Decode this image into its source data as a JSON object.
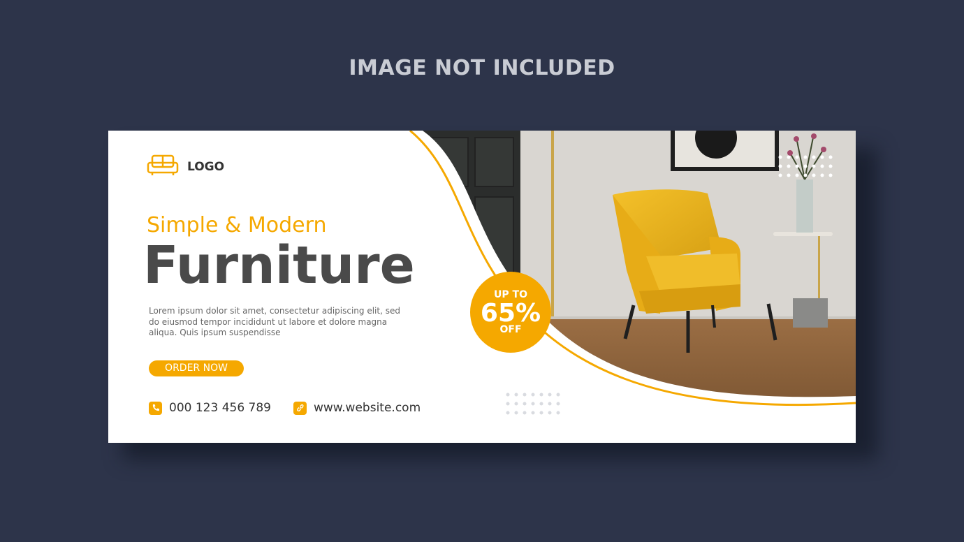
{
  "header": {
    "label": "IMAGE NOT INCLUDED"
  },
  "banner": {
    "logo": {
      "icon": "sofa-icon",
      "text": "LOGO"
    },
    "subtitle": "Simple & Modern",
    "title": "Furniture",
    "body": "Lorem ipsum dolor sit amet, consectetur adipiscing elit, sed do eiusmod tempor incididunt ut labore et dolore magna aliqua. Quis ipsum suspendisse",
    "order_button": "ORDER NOW",
    "phone": {
      "icon": "phone-icon",
      "text": "000 123 456 789"
    },
    "website": {
      "icon": "link-icon",
      "text": "www.website.com"
    },
    "badge": {
      "line1": "UP TO",
      "line2": "65%",
      "line3": "OFF"
    },
    "photo": {
      "subject": "yellow-armchair-photo"
    }
  },
  "colors": {
    "background": "#2d344a",
    "accent": "#f5a800",
    "title": "#4a4a4a",
    "banner": "#ffffff"
  }
}
